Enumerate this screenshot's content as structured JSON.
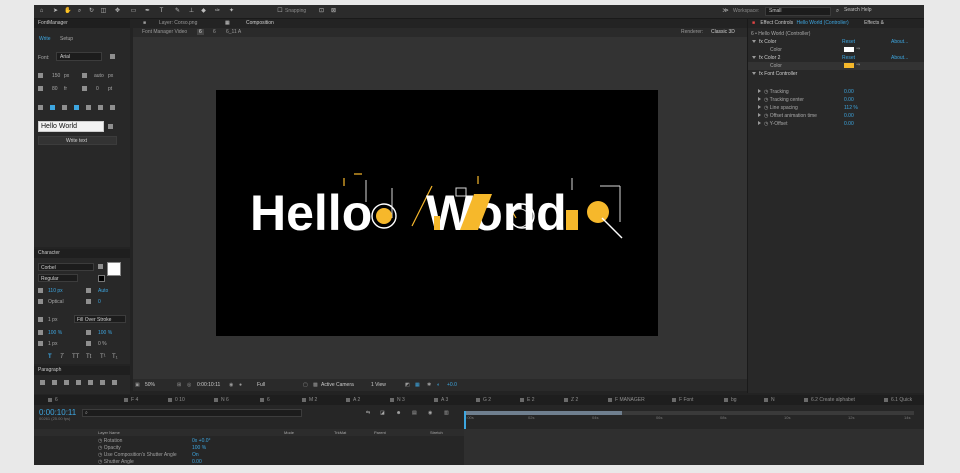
{
  "colors": {
    "accent": "#3da6e0",
    "yellow": "#f6b82b",
    "canvas": "#000000"
  },
  "toolbar": {
    "snapping_label": "Snapping",
    "workspace_label": "Workspace:",
    "workspace_value": "Small",
    "search_placeholder": "Search Help",
    "tools": [
      "home-icon",
      "arrow-icon",
      "hand-icon",
      "zoom-icon",
      "rotate-icon",
      "camera-icon",
      "pan-behind-icon",
      "rect-icon",
      "pen-icon",
      "type-icon",
      "brush-icon",
      "clone-icon",
      "eraser-icon",
      "roto-icon",
      "pin-icon"
    ]
  },
  "font_manager": {
    "title": "FontManager",
    "tabs": [
      "Write",
      "Setup"
    ],
    "font_label": "Font:",
    "font_value": "Arial",
    "size_value": "150",
    "size_unit": "px",
    "kern_label": "auto",
    "kern_unit": "px",
    "leading_value": "80",
    "leading_unit": "fr",
    "tracking_value": "0",
    "tracking_unit": "pt",
    "text_value": "Hello World",
    "write_button": "Write text"
  },
  "character": {
    "title": "Character",
    "font": "Corbel",
    "style": "Regular",
    "size": "110 px",
    "leading": "Auto",
    "kerning": "Optical",
    "tracking": "0",
    "stroke": "1 px",
    "stroke_mode": "Fill Over Stroke",
    "vscale": "100 %",
    "hscale": "100 %",
    "baseline": "1 px",
    "tsume": "0 %"
  },
  "paragraph": {
    "title": "Paragraph"
  },
  "comp_tabs": {
    "layer_tab": "Layer: Corso.png",
    "comp_tab": "Composition",
    "comp_name": "Font Manager Video",
    "breadcrumbs": [
      "6",
      "6",
      "6_11 A"
    ],
    "renderer_label": "Renderer:",
    "renderer_value": "Classic 3D"
  },
  "canvas_text": {
    "part1": "Hello",
    "part2": "World"
  },
  "comp_footer": {
    "zoom": "50%",
    "timecode": "0:00:10:11",
    "resolution": "Full",
    "camera": "Active Camera",
    "view": "1 View",
    "exposure": "+0.0"
  },
  "effect_controls": {
    "tab": "Effect Controls",
    "layer_name": "Hello World (Controller)",
    "other_tab": "Effects &",
    "path": "6 • Hello World (Controller)",
    "reset": "Reset",
    "about": "About...",
    "rows": [
      {
        "name": "Color",
        "type": "effect"
      },
      {
        "name": "Color",
        "type": "param-color-white"
      },
      {
        "name": "Color 2",
        "type": "effect"
      },
      {
        "name": "Color",
        "type": "param-color-yellow"
      },
      {
        "name": "Font Controller",
        "type": "effect"
      }
    ],
    "params": [
      {
        "name": "Tracking",
        "value": "0.00"
      },
      {
        "name": "Tracking center",
        "value": "0.00"
      },
      {
        "name": "Line spacing",
        "value": "112 %"
      },
      {
        "name": "Offset animation time",
        "value": "0.00"
      },
      {
        "name": "Y-Offset",
        "value": "0.00"
      }
    ]
  },
  "timeline": {
    "tabs": [
      "6",
      "F 4",
      "0 10",
      "N 6",
      "6",
      "M 2",
      "A 2",
      "N 3",
      "A 3",
      "G 2",
      "E 2",
      "Z 2",
      "F MANAGER",
      "F Font",
      "bg",
      "N",
      "6.2 Create alphabet",
      "6.1 Quick"
    ],
    "timecode": "0:00:10:11",
    "fps": "00261 (25.00 fps)",
    "columns": {
      "layer_name": "Layer Name",
      "mode": "Mode",
      "trkmat": "TrkMat",
      "parent": "Parent",
      "stretch": "Stretch"
    },
    "ruler": [
      "0:00s",
      "02s",
      "04s",
      "06s",
      "08s",
      "10s",
      "12s",
      "14s"
    ],
    "rows": [
      {
        "name": "Rotation",
        "value": "0x +0.0°"
      },
      {
        "name": "Opacity",
        "value": "100 %"
      },
      {
        "name": "Use Composition's Shutter Angle",
        "value": "On"
      },
      {
        "name": "Shutter Angle",
        "value": "0.00"
      }
    ]
  }
}
